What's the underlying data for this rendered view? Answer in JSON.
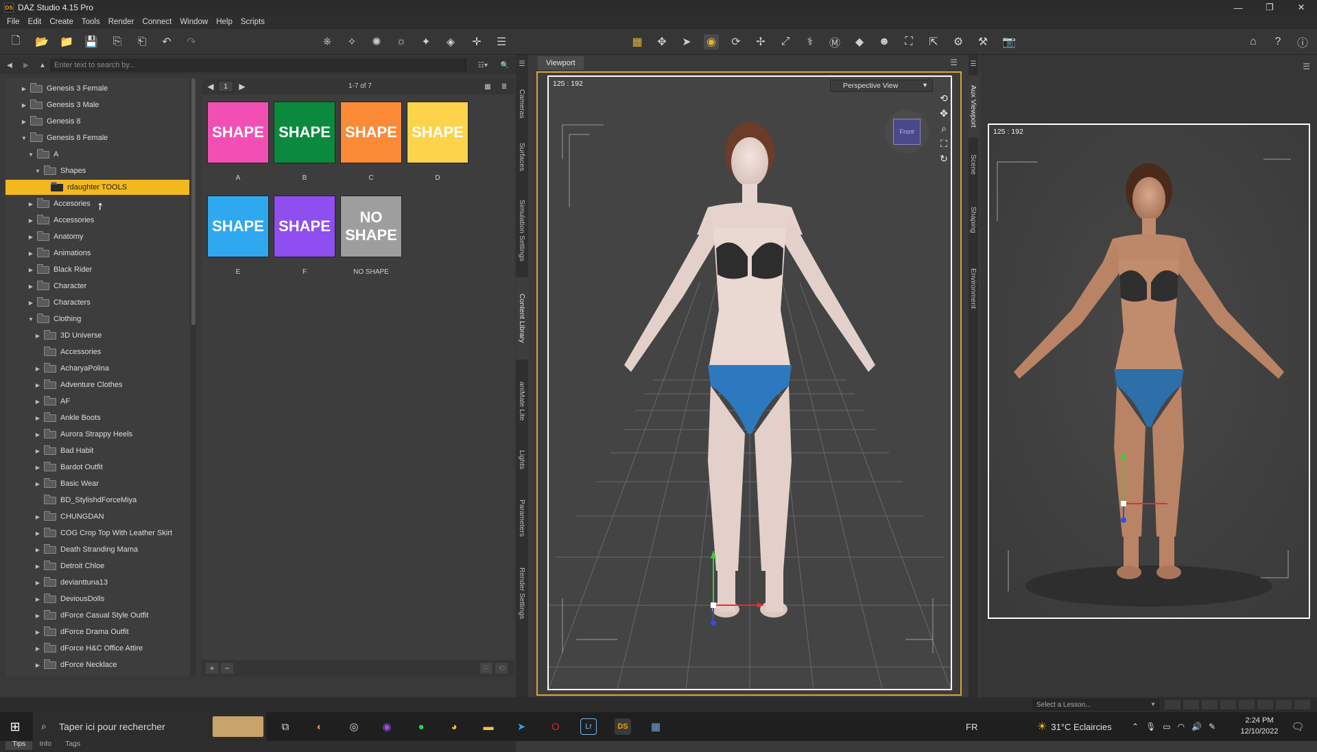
{
  "window": {
    "logo_text": "DS",
    "title": "DAZ Studio 4.15 Pro",
    "minimize": "—",
    "maximize": "❐",
    "close": "✕"
  },
  "menu": [
    "File",
    "Edit",
    "Create",
    "Tools",
    "Render",
    "Connect",
    "Window",
    "Help",
    "Scripts"
  ],
  "search": {
    "placeholder": "Enter text to search by..."
  },
  "tree": {
    "items": [
      {
        "label": "Genesis 3 Female",
        "depth": 1,
        "arrow": "▶"
      },
      {
        "label": "Genesis 3 Male",
        "depth": 1,
        "arrow": "▶"
      },
      {
        "label": "Genesis 8",
        "depth": 1,
        "arrow": "▶"
      },
      {
        "label": "Genesis 8 Female",
        "depth": 1,
        "arrow": "▼"
      },
      {
        "label": "A",
        "depth": 2,
        "arrow": "▼"
      },
      {
        "label": "Shapes",
        "depth": 3,
        "arrow": "▼"
      },
      {
        "label": "rdaughter TOOLS",
        "depth": 4,
        "arrow": "",
        "selected": true
      },
      {
        "label": "Accesories",
        "depth": 2,
        "arrow": "▶"
      },
      {
        "label": "Accessories",
        "depth": 2,
        "arrow": "▶"
      },
      {
        "label": "Anatomy",
        "depth": 2,
        "arrow": "▶"
      },
      {
        "label": "Animations",
        "depth": 2,
        "arrow": "▶"
      },
      {
        "label": "Black Rider",
        "depth": 2,
        "arrow": "▶"
      },
      {
        "label": "Character",
        "depth": 2,
        "arrow": "▶"
      },
      {
        "label": "Characters",
        "depth": 2,
        "arrow": "▶"
      },
      {
        "label": "Clothing",
        "depth": 2,
        "arrow": "▼"
      },
      {
        "label": "3D Universe",
        "depth": 3,
        "arrow": "▶"
      },
      {
        "label": "Accessories",
        "depth": 3,
        "arrow": ""
      },
      {
        "label": "AcharyaPolina",
        "depth": 3,
        "arrow": "▶"
      },
      {
        "label": "Adventure Clothes",
        "depth": 3,
        "arrow": "▶"
      },
      {
        "label": "AF",
        "depth": 3,
        "arrow": "▶"
      },
      {
        "label": "Ankle Boots",
        "depth": 3,
        "arrow": "▶"
      },
      {
        "label": "Aurora Strappy Heels",
        "depth": 3,
        "arrow": "▶"
      },
      {
        "label": "Bad Habit",
        "depth": 3,
        "arrow": "▶"
      },
      {
        "label": "Bardot Outfit",
        "depth": 3,
        "arrow": "▶"
      },
      {
        "label": "Basic Wear",
        "depth": 3,
        "arrow": "▶"
      },
      {
        "label": "BD_StylishdForceMiya",
        "depth": 3,
        "arrow": ""
      },
      {
        "label": "CHUNGDAN",
        "depth": 3,
        "arrow": "▶"
      },
      {
        "label": "COG Crop Top With Leather Skirt",
        "depth": 3,
        "arrow": "▶"
      },
      {
        "label": "Death Stranding Mama",
        "depth": 3,
        "arrow": "▶"
      },
      {
        "label": "Detroit Chloe",
        "depth": 3,
        "arrow": "▶"
      },
      {
        "label": "devianttuna13",
        "depth": 3,
        "arrow": "▶"
      },
      {
        "label": "DeviousDolls",
        "depth": 3,
        "arrow": "▶"
      },
      {
        "label": "dForce Casual Style Outfit",
        "depth": 3,
        "arrow": "▶"
      },
      {
        "label": "dForce Drama Outfit",
        "depth": 3,
        "arrow": "▶"
      },
      {
        "label": "dForce H&C Office Attire",
        "depth": 3,
        "arrow": "▶"
      },
      {
        "label": "dForce Necklace",
        "depth": 3,
        "arrow": "▶"
      }
    ]
  },
  "content": {
    "page": "1",
    "count": "1-7 of 7",
    "items": [
      {
        "text": "SHAPE",
        "caption": "A",
        "color": "#f24fb4"
      },
      {
        "text": "SHAPE",
        "caption": "B",
        "color": "#0b8a3e"
      },
      {
        "text": "SHAPE",
        "caption": "C",
        "color": "#fb8a37"
      },
      {
        "text": "SHAPE",
        "caption": "D",
        "color": "#fcd34a"
      },
      {
        "text": "SHAPE",
        "caption": "E",
        "color": "#2fa8f0"
      },
      {
        "text": "SHAPE",
        "caption": "F",
        "color": "#8e4ef0"
      },
      {
        "text": "NO SHAPE",
        "caption": "NO SHAPE",
        "color": "#9e9e9e"
      }
    ]
  },
  "left_vtabs": [
    "Cameras",
    "Surfaces",
    "Simulation Settings",
    "Content Library",
    "aniMate Lite",
    "Lights",
    "Parameters",
    "Render Settings"
  ],
  "bottom_tabs": [
    "Tips",
    "Info",
    "Tags"
  ],
  "viewport": {
    "tab": "Viewport",
    "info": "125 : 192",
    "view": "Perspective View",
    "cube_label": "Front"
  },
  "right_vtabs": [
    "Aux Viewport",
    "Scene",
    "Shaping",
    "Environment"
  ],
  "aux": {
    "info": "125 : 192"
  },
  "lesson": {
    "placeholder": "Select a Lesson..."
  },
  "taskbar": {
    "search": "Taper ici pour rechercher",
    "lang": "FR",
    "weather": "31°C  Eclaircies",
    "time": "2:24 PM",
    "date": "12/10/2022"
  }
}
